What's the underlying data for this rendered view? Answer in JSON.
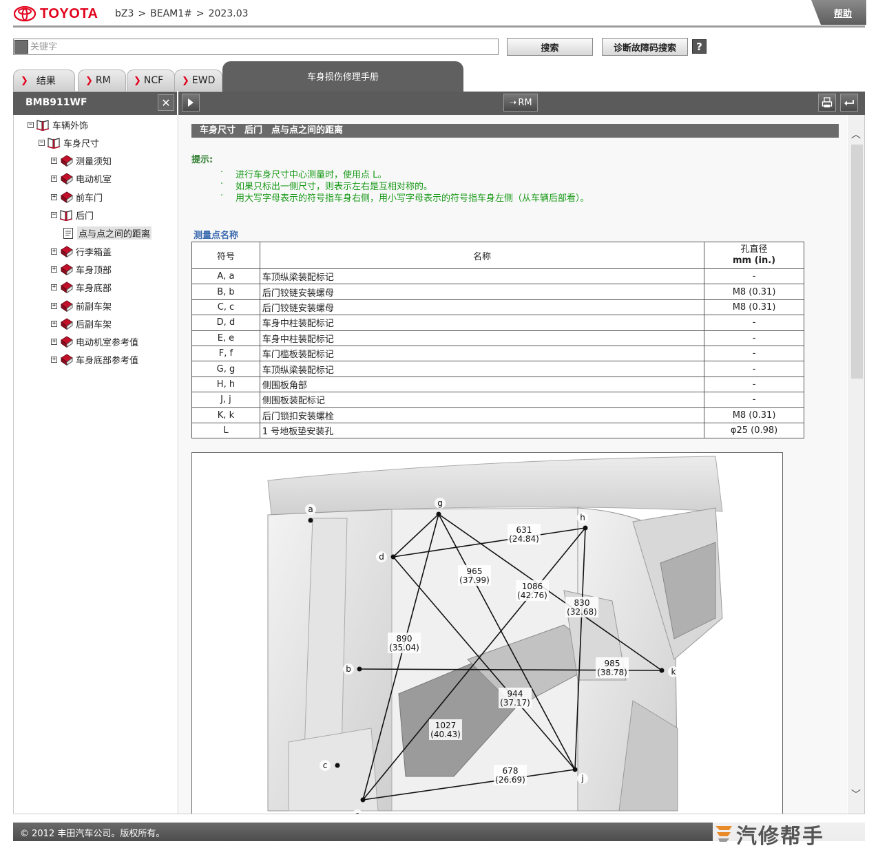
{
  "header": {
    "brand": "TOYOTA",
    "breadcrumb": [
      "bZ3",
      ">",
      "BEAM1#",
      ">",
      "2023.03"
    ],
    "help_label": "帮助"
  },
  "search": {
    "placeholder": "关键字",
    "search_button": "搜索",
    "dtc_button": "诊断故障码搜索",
    "help_q": "?"
  },
  "tabs": [
    {
      "label": "结果"
    },
    {
      "label": "RM"
    },
    {
      "label": "NCF"
    },
    {
      "label": "EWD"
    }
  ],
  "active_tab": "车身损伤修理手册",
  "left_panel": {
    "title": "BMB911WF",
    "close": "✕"
  },
  "toolbar": {
    "rm_label": "RM"
  },
  "tree": [
    {
      "label": "车辆外饰",
      "level": 0,
      "state": "open",
      "icon": "book-open"
    },
    {
      "label": "车身尺寸",
      "level": 1,
      "state": "open",
      "icon": "book-open"
    },
    {
      "label": "测量须知",
      "level": 2,
      "state": "closed",
      "icon": "book-closed"
    },
    {
      "label": "电动机室",
      "level": 2,
      "state": "closed",
      "icon": "book-closed"
    },
    {
      "label": "前车门",
      "level": 2,
      "state": "closed",
      "icon": "book-closed"
    },
    {
      "label": "后门",
      "level": 2,
      "state": "open",
      "icon": "book-open"
    },
    {
      "label": "点与点之间的距离",
      "level": 3,
      "state": "leaf",
      "icon": "doc",
      "selected": true
    },
    {
      "label": "行李箱盖",
      "level": 2,
      "state": "closed",
      "icon": "book-closed"
    },
    {
      "label": "车身顶部",
      "level": 2,
      "state": "closed",
      "icon": "book-closed"
    },
    {
      "label": "车身底部",
      "level": 2,
      "state": "closed",
      "icon": "book-closed"
    },
    {
      "label": "前副车架",
      "level": 2,
      "state": "closed",
      "icon": "book-closed"
    },
    {
      "label": "后副车架",
      "level": 2,
      "state": "closed",
      "icon": "book-closed"
    },
    {
      "label": "电动机室参考值",
      "level": 2,
      "state": "closed",
      "icon": "book-closed"
    },
    {
      "label": "车身底部参考值",
      "level": 2,
      "state": "closed",
      "icon": "book-closed"
    }
  ],
  "content": {
    "section_title": "车身尺寸　后门　点与点之间的距离",
    "hint_label": "提示:",
    "hints": [
      "进行车身尺寸中心测量时，使用点 L。",
      "如果只标出一侧尺寸，则表示左右是互相对称的。",
      "用大写字母表示的符号指车身右侧，用小写字母表示的符号指车身左侧（从车辆后部看）。"
    ],
    "bullet": "·",
    "table_title": "测量点名称",
    "table_headers": [
      "符号",
      "名称",
      "孔直径",
      "mm (in.)"
    ],
    "table_rows": [
      {
        "sym": "A, a",
        "name": "车顶纵梁装配标记",
        "dia": "-"
      },
      {
        "sym": "B, b",
        "name": "后门铰链安装螺母",
        "dia": "M8 (0.31)"
      },
      {
        "sym": "C, c",
        "name": "后门铰链安装螺母",
        "dia": "M8 (0.31)"
      },
      {
        "sym": "D, d",
        "name": "车身中柱装配标记",
        "dia": "-"
      },
      {
        "sym": "E, e",
        "name": "车身中柱装配标记",
        "dia": "-"
      },
      {
        "sym": "F, f",
        "name": "车门槛板装配标记",
        "dia": "-"
      },
      {
        "sym": "G, g",
        "name": "车顶纵梁装配标记",
        "dia": "-"
      },
      {
        "sym": "H, h",
        "name": "侧围板角部",
        "dia": "-"
      },
      {
        "sym": "J, j",
        "name": "侧围板装配标记",
        "dia": "-"
      },
      {
        "sym": "K, k",
        "name": "后门锁扣安装螺栓",
        "dia": "M8 (0.31)"
      },
      {
        "sym": "L",
        "name": "1 号地板垫安装孔",
        "dia": "φ25 (0.98)"
      }
    ]
  },
  "diagram": {
    "points": {
      "a": "a",
      "g": "g",
      "h": "h",
      "d": "d",
      "b": "b",
      "k": "k",
      "c": "c",
      "j": "j",
      "e": "e"
    },
    "measurements": [
      {
        "mm": "631",
        "in": "(24.84)"
      },
      {
        "mm": "965",
        "in": "(37.99)"
      },
      {
        "mm": "1086",
        "in": "(42.76)"
      },
      {
        "mm": "830",
        "in": "(32.68)"
      },
      {
        "mm": "890",
        "in": "(35.04)"
      },
      {
        "mm": "985",
        "in": "(38.78)"
      },
      {
        "mm": "944",
        "in": "(37.17)"
      },
      {
        "mm": "1027",
        "in": "(40.43)"
      },
      {
        "mm": "678",
        "in": "(26.69)"
      }
    ]
  },
  "footer": {
    "copyright": "© 2012 丰田汽车公司。版权所有。",
    "watermark": "汽修帮手"
  },
  "colors": {
    "accent_red": "#e2001a",
    "bar_gray": "#5b5b5b",
    "hint_green": "#1a9a1a",
    "title_blue": "#3a6ab0"
  }
}
